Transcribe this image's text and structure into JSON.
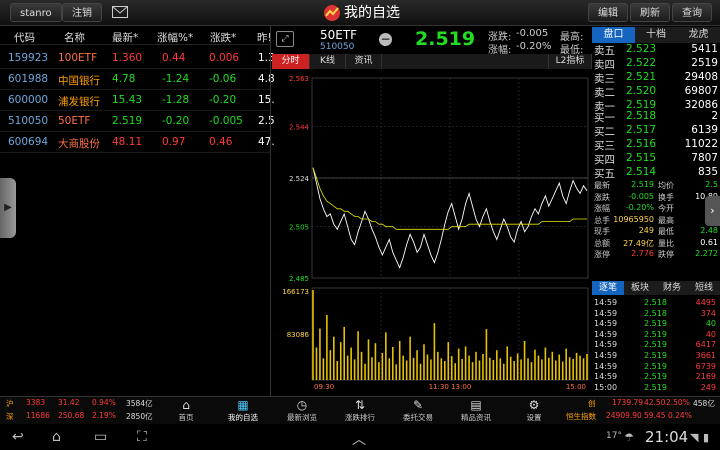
{
  "topbar": {
    "user": "stanro",
    "logout": "注销",
    "title": "我的自选",
    "edit": "编辑",
    "refresh": "刷新",
    "search": "查询"
  },
  "list": {
    "headers": [
      "代码",
      "名称",
      "最新*",
      "涨幅%*",
      "涨跌*",
      "昨!"
    ],
    "rows": [
      {
        "code": "159923",
        "name": "100ETF",
        "latest": "1.360",
        "pct": "0.44",
        "chg": "0.006",
        "prev": "1.3",
        "dir": "up"
      },
      {
        "code": "601988",
        "name": "中国银行",
        "latest": "4.78",
        "pct": "-1.24",
        "chg": "-0.06",
        "prev": "4.8",
        "dir": "down"
      },
      {
        "code": "600000",
        "name": "浦发银行",
        "latest": "15.43",
        "pct": "-1.28",
        "chg": "-0.20",
        "prev": "15.",
        "dir": "down"
      },
      {
        "code": "510050",
        "name": "50ETF",
        "latest": "2.519",
        "pct": "-0.20",
        "chg": "-0.005",
        "prev": "2.5",
        "dir": "down"
      },
      {
        "code": "600694",
        "name": "大商股份",
        "latest": "48.11",
        "pct": "0.97",
        "chg": "0.46",
        "prev": "47.",
        "dir": "up"
      }
    ]
  },
  "quote": {
    "name": "50ETF",
    "code": "510050",
    "price": "2.519",
    "change_label": "涨跌:",
    "change": "-0.005",
    "pct_label": "涨幅:",
    "pct": "-0.20%",
    "high_label": "最高:",
    "low_label": "最低:"
  },
  "chart_tabs": [
    "分时",
    "K线",
    "资讯",
    "L2指标"
  ],
  "chart_data": {
    "type": "line",
    "title": "",
    "y_ticks": [
      "2.563",
      "2.544",
      "2.524",
      "2.505",
      "2.485"
    ],
    "ylim": [
      2.485,
      2.563
    ],
    "x_ticks": [
      "09:30",
      "11:30 13:00",
      "15:00"
    ],
    "vol_ticks": [
      "166173",
      "83086"
    ],
    "series": [
      {
        "values": [
          2.528,
          2.522,
          2.516,
          2.512,
          2.509,
          2.51,
          2.506,
          2.504,
          2.507,
          2.51,
          2.505,
          2.5,
          2.498,
          2.503,
          2.507,
          2.511,
          2.508,
          2.504,
          2.501,
          2.497,
          2.494,
          2.497,
          2.5,
          2.495,
          2.492,
          2.489,
          2.493,
          2.498,
          2.502,
          2.499,
          2.495,
          2.497,
          2.502,
          2.498,
          2.494,
          2.491,
          2.495,
          2.5,
          2.506,
          2.511,
          2.514,
          2.509,
          2.504,
          2.508,
          2.514,
          2.518,
          2.513,
          2.508,
          2.505,
          2.509,
          2.512,
          2.507,
          2.503,
          2.5,
          2.504,
          2.508,
          2.505,
          2.501,
          2.499,
          2.504,
          2.507,
          2.503,
          2.505,
          2.509,
          2.512,
          2.51,
          2.514,
          2.517,
          2.513,
          2.516,
          2.519,
          2.522,
          2.517,
          2.514,
          2.519,
          2.523,
          2.52,
          2.518,
          2.521,
          2.519
        ]
      },
      {
        "values": [
          2.528,
          2.524,
          2.52,
          2.517,
          2.515,
          2.514,
          2.513,
          2.512,
          2.512,
          2.511,
          2.511,
          2.51,
          2.509,
          2.509,
          2.508,
          2.508,
          2.508,
          2.507,
          2.507,
          2.506,
          2.506,
          2.505,
          2.505,
          2.505,
          2.504,
          2.504,
          2.504,
          2.504,
          2.504,
          2.504,
          2.504,
          2.504,
          2.504,
          2.504,
          2.504,
          2.504,
          2.504,
          2.504,
          2.504,
          2.504,
          2.505,
          2.505,
          2.505,
          2.505,
          2.505,
          2.506,
          2.506,
          2.506,
          2.506,
          2.506,
          2.506,
          2.506,
          2.506,
          2.506,
          2.506,
          2.506,
          2.506,
          2.506,
          2.506,
          2.506,
          2.506,
          2.506,
          2.506,
          2.506,
          2.506,
          2.506,
          2.507,
          2.507,
          2.507,
          2.507,
          2.507,
          2.507,
          2.507,
          2.507,
          2.507,
          2.508,
          2.508,
          2.508,
          2.508,
          2.508
        ]
      }
    ],
    "prev_close": 2.524,
    "volume": [
      166173,
      60000,
      95000,
      40000,
      120000,
      55000,
      80000,
      35000,
      70000,
      98000,
      45000,
      60000,
      38000,
      90000,
      52000,
      30000,
      75000,
      42000,
      68000,
      33000,
      50000,
      88000,
      40000,
      61000,
      29000,
      72000,
      45000,
      36000,
      80000,
      41000,
      55000,
      30000,
      66000,
      47000,
      38000,
      105000,
      52000,
      40000,
      35000,
      70000,
      44000,
      31000,
      58000,
      39000,
      62000,
      45000,
      33000,
      52000,
      36000,
      48000,
      94000,
      41000,
      37000,
      55000,
      40000,
      30000,
      62000,
      43000,
      35000,
      49000,
      38000,
      72000,
      40000,
      33000,
      56000,
      45000,
      38000,
      60000,
      41000,
      52000,
      36000,
      47000,
      34000,
      58000,
      42000,
      39000,
      50000,
      45000,
      40000,
      48000
    ]
  },
  "right_panel": {
    "tabs": [
      "盘口",
      "十档",
      "龙虎"
    ],
    "sells": [
      {
        "label": "卖五",
        "price": "2.523",
        "vol": "5411"
      },
      {
        "label": "卖四",
        "price": "2.522",
        "vol": "2519"
      },
      {
        "label": "卖三",
        "price": "2.521",
        "vol": "29408"
      },
      {
        "label": "卖二",
        "price": "2.520",
        "vol": "69807"
      },
      {
        "label": "卖一",
        "price": "2.519",
        "vol": "32086"
      }
    ],
    "buys": [
      {
        "label": "买一",
        "price": "2.518",
        "vol": "2"
      },
      {
        "label": "买二",
        "price": "2.517",
        "vol": "6139"
      },
      {
        "label": "买三",
        "price": "2.516",
        "vol": "11022"
      },
      {
        "label": "买四",
        "price": "2.515",
        "vol": "7807"
      },
      {
        "label": "买五",
        "price": "2.514",
        "vol": "835"
      }
    ],
    "stats": [
      {
        "l1": "最新",
        "v1": "2.519",
        "l2": "均价",
        "v2": "2.5"
      },
      {
        "l1": "涨跌",
        "v1": "-0.005",
        "l2": "换手",
        "v2": "10.80"
      },
      {
        "l1": "涨幅",
        "v1": "-0.20%",
        "l2": "今开",
        "v2": "2.5"
      },
      {
        "l1": "总手",
        "v1": "10965950",
        "l2": "最高",
        "v2": "2.5"
      },
      {
        "l1": "现手",
        "v1": "249",
        "l2": "最低",
        "v2": "2.48"
      },
      {
        "l1": "总额",
        "v1": "27.49亿",
        "l2": "量比",
        "v2": "0.61"
      },
      {
        "l1": "涨停",
        "v1": "2.776",
        "l2": "跌停",
        "v2": "2.272"
      }
    ],
    "tabs2": [
      "逐笔",
      "板块",
      "财务",
      "短线"
    ],
    "trades": [
      {
        "time": "14:59",
        "price": "2.518",
        "vol": "4495"
      },
      {
        "time": "14:59",
        "price": "2.518",
        "vol": "374"
      },
      {
        "time": "14:59",
        "price": "2.519",
        "vol": "40"
      },
      {
        "time": "14:59",
        "price": "2.519",
        "vol": "40"
      },
      {
        "time": "14:59",
        "price": "2.519",
        "vol": "6417"
      },
      {
        "time": "14:59",
        "price": "2.519",
        "vol": "3661"
      },
      {
        "time": "14:59",
        "price": "2.519",
        "vol": "6739"
      },
      {
        "time": "14:59",
        "price": "2.519",
        "vol": "2169"
      },
      {
        "time": "15:00",
        "price": "2.519",
        "vol": "249"
      }
    ]
  },
  "ticker": {
    "sh": {
      "label": "沪",
      "v1": "3383",
      "v2": "31.42",
      "v3": "0.94%",
      "v4": "3584亿"
    },
    "sz": {
      "label": "深",
      "v1": "11686",
      "v2": "250.68",
      "v3": "2.19%",
      "v4": "2850亿"
    },
    "right1": {
      "label": "创",
      "v1": "1739.79",
      "v2": "42.50",
      "v3": "2.50%",
      "v4": "458亿"
    },
    "right2": {
      "label": "恒生指数",
      "v1": "24909.90",
      "v2": "59.45",
      "v3": "0.24%"
    }
  },
  "nav": [
    "首页",
    "我的自选",
    "最新浏览",
    "涨跌排行",
    "委托交易",
    "精品资讯",
    "设置"
  ],
  "system": {
    "temp": "17°",
    "time": "21:04"
  }
}
